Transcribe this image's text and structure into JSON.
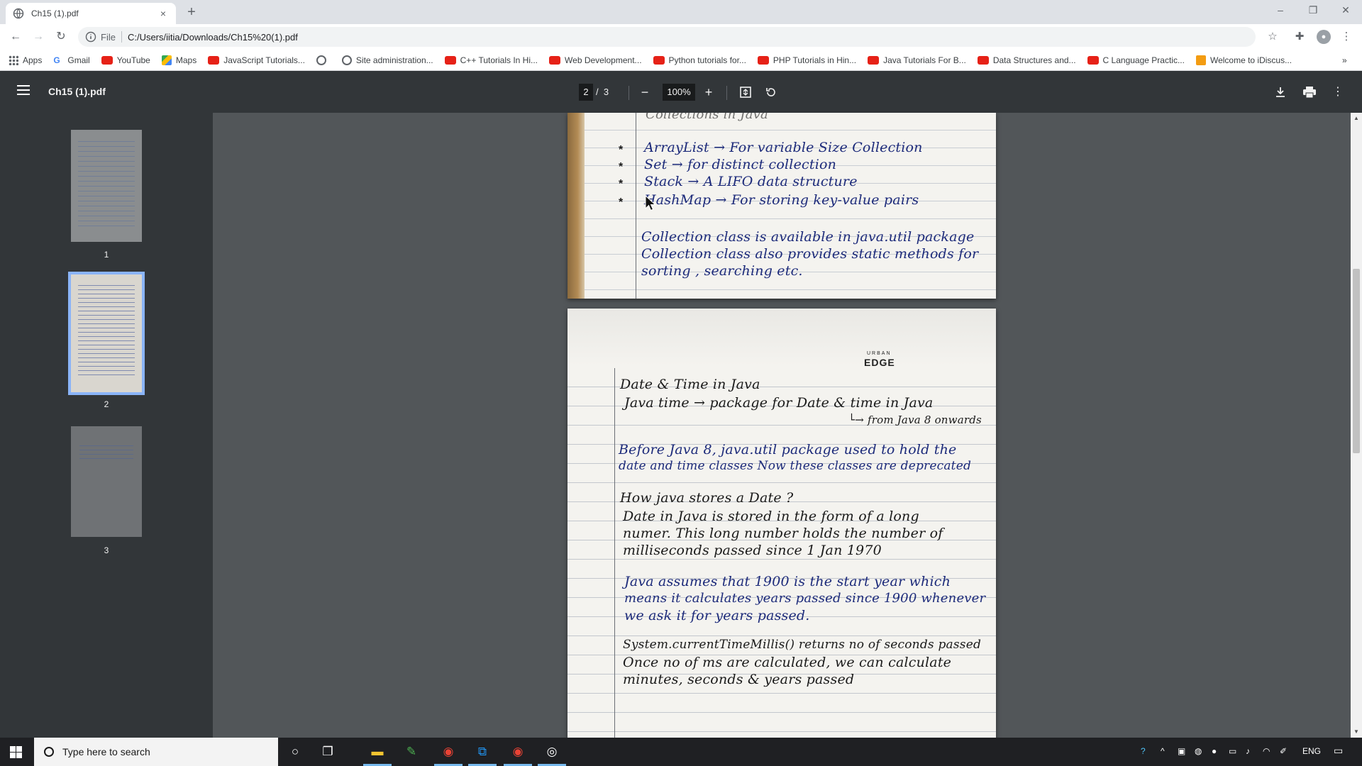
{
  "browser": {
    "tab_title": "Ch15 (1).pdf",
    "tab_close": "×",
    "new_tab": "+",
    "address_label": "File",
    "address_url": "C:/Users/iitia/Downloads/Ch15%20(1).pdf",
    "window_controls": [
      "–",
      "❐",
      "✕"
    ]
  },
  "bookmarks": [
    {
      "label": "Apps",
      "icon": "apps-grid-icon"
    },
    {
      "label": "Gmail",
      "icon": "google-icon"
    },
    {
      "label": "YouTube",
      "icon": "youtube-icon"
    },
    {
      "label": "Maps",
      "icon": "maps-icon"
    },
    {
      "label": "JavaScript Tutorials...",
      "icon": "youtube-icon"
    },
    {
      "label": "",
      "icon": "globe-icon"
    },
    {
      "label": "Site administration...",
      "icon": "globe-icon"
    },
    {
      "label": "C++ Tutorials In Hi...",
      "icon": "youtube-icon"
    },
    {
      "label": "Web Development...",
      "icon": "youtube-icon"
    },
    {
      "label": "Python tutorials for...",
      "icon": "youtube-icon"
    },
    {
      "label": "PHP Tutorials in Hin...",
      "icon": "youtube-icon"
    },
    {
      "label": "Java Tutorials For B...",
      "icon": "youtube-icon"
    },
    {
      "label": "Data Structures and...",
      "icon": "youtube-icon"
    },
    {
      "label": "C Language Practic...",
      "icon": "youtube-icon"
    },
    {
      "label": "Welcome to iDiscus...",
      "icon": "idiscuss-icon"
    }
  ],
  "bookmarks_more": "»",
  "pdf": {
    "file_name": "Ch15 (1).pdf",
    "current_page": "2",
    "page_sep": "/",
    "total_pages": "3",
    "zoom": "100%",
    "zoom_out": "−",
    "zoom_in": "+"
  },
  "thumbnails": [
    "1",
    "2",
    "3"
  ],
  "page_top": {
    "heading_fragment": "Collections in Java",
    "bullets": [
      "ArrayList → For variable Size Collection",
      "Set → for distinct collection",
      "Stack → A LIFO data structure",
      "HashMap → For storing key-value pairs"
    ],
    "bullet_mark": "*",
    "para": [
      "Collection class is available in java.util package",
      "Collection class also provides static methods for",
      "sorting , searching etc."
    ]
  },
  "page_bottom": {
    "brand": "EDGE",
    "brand_small": "URBAN",
    "lines": [
      "Date & Time in Java",
      "Java time → package for Date & time in Java",
      "└→ from Java 8 onwards",
      "Before Java 8, java.util package used to hold the",
      "date and time classes Now these classes are deprecated",
      "How java stores a Date ?",
      "Date in Java is stored in the form of a long",
      "numer. This long number holds the number of",
      "milliseconds passed since 1 Jan 1970",
      "Java assumes that 1900 is the start year which",
      "means it calculates years passed since 1900 whenever",
      "we ask it for years passed.",
      "System.currentTimeMillis() returns no of seconds passed",
      "Once no of ms are calculated, we can calculate",
      "minutes, seconds & years passed"
    ]
  },
  "taskbar": {
    "search_placeholder": "Type here to search",
    "lang": "ENG"
  }
}
